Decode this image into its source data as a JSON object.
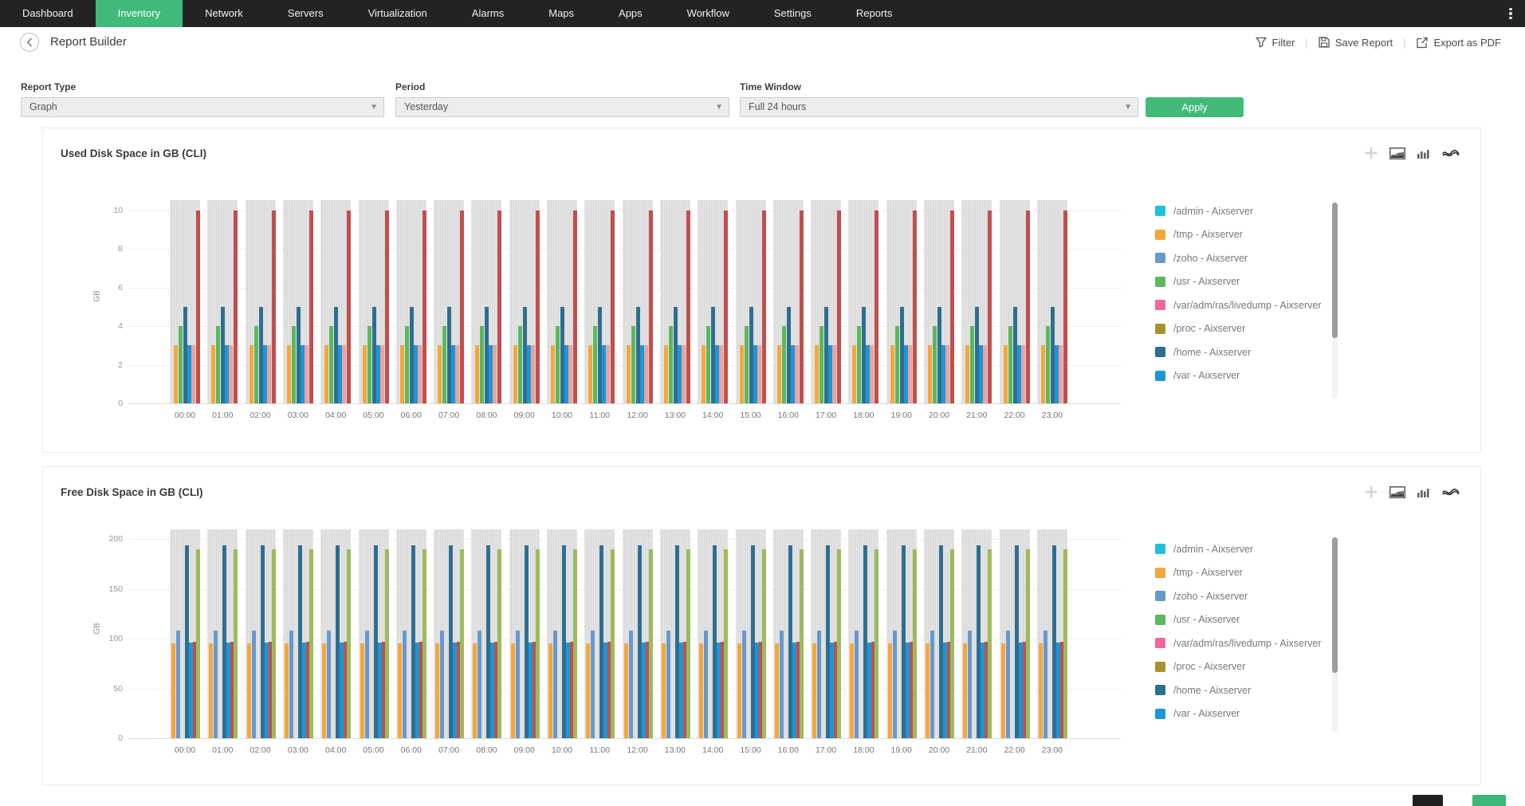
{
  "nav": {
    "items": [
      {
        "label": "Dashboard",
        "active": false
      },
      {
        "label": "Inventory",
        "active": true
      },
      {
        "label": "Network",
        "active": false
      },
      {
        "label": "Servers",
        "active": false
      },
      {
        "label": "Virtualization",
        "active": false
      },
      {
        "label": "Alarms",
        "active": false
      },
      {
        "label": "Maps",
        "active": false
      },
      {
        "label": "Apps",
        "active": false
      },
      {
        "label": "Workflow",
        "active": false
      },
      {
        "label": "Settings",
        "active": false
      },
      {
        "label": "Reports",
        "active": false
      }
    ],
    "overflow_icon": "kebab-menu-icon"
  },
  "header": {
    "title": "Report Builder",
    "back_icon": "chevron-left-icon",
    "actions": [
      {
        "label": "Filter",
        "icon": "filter-icon"
      },
      {
        "label": "Save Report",
        "icon": "save-icon"
      },
      {
        "label": "Export as PDF",
        "icon": "export-icon"
      }
    ]
  },
  "filters": {
    "report_type_label": "Report Type",
    "report_type_value": "Graph",
    "period_label": "Period",
    "period_value": "Yesterday",
    "time_window_label": "Time Window",
    "time_window_value": "Full 24 hours",
    "apply_label": "Apply"
  },
  "panel_tool_icons": [
    "add-icon",
    "area-chart-icon",
    "bar-chart-icon",
    "stream-chart-icon"
  ],
  "legend": [
    {
      "label": "/admin - Aixserver",
      "color": "#1EC1D9"
    },
    {
      "label": "/tmp - Aixserver",
      "color": "#F5A63C"
    },
    {
      "label": "/zoho - Aixserver",
      "color": "#6699CC"
    },
    {
      "label": "/usr - Aixserver",
      "color": "#5CB85C"
    },
    {
      "label": "/var/adm/ras/livedump - Aixserver",
      "color": "#F0679E"
    },
    {
      "label": "/proc - Aixserver",
      "color": "#A89230"
    },
    {
      "label": "/home - Aixserver",
      "color": "#2E6E91"
    },
    {
      "label": "/var - Aixserver",
      "color": "#1E96D6"
    }
  ],
  "chart_data": [
    {
      "type": "bar",
      "title": "Used Disk Space in GB (CLI)",
      "xlabel": "",
      "ylabel": "GB",
      "ylim": [
        0,
        10
      ],
      "yticks": [
        0,
        2,
        4,
        6,
        8,
        10
      ],
      "grid": true,
      "legend_position": "right",
      "legend_scrollable": true,
      "categories": [
        "00:00",
        "01:00",
        "02:00",
        "03:00",
        "04:00",
        "05:00",
        "06:00",
        "07:00",
        "08:00",
        "09:00",
        "10:00",
        "11:00",
        "12:00",
        "13:00",
        "14:00",
        "15:00",
        "16:00",
        "17:00",
        "18:00",
        "19:00",
        "20:00",
        "21:00",
        "22:00",
        "23:00"
      ],
      "series": [
        {
          "name": "/tmp - Aixserver",
          "color": "#F5A63C",
          "value_all_hours": 3
        },
        {
          "name": "/usr - Aixserver",
          "color": "#5CB85C",
          "value_all_hours": 4
        },
        {
          "name": "/home - Aixserver",
          "color": "#2E6E91",
          "value_all_hours": 5
        },
        {
          "name": "/var - Aixserver",
          "color": "#1E96D6",
          "value_all_hours": 3
        },
        {
          "name": "unlabeled-salmon-series",
          "color": "#EBA3A0",
          "value_all_hours": 3
        },
        {
          "name": "unlabeled-red-series",
          "color": "#C0504D",
          "value_all_hours": 10
        }
      ],
      "background_band": {
        "style": "striped-gray",
        "color": "#E0E0E0",
        "extends_above_max_tick": true
      }
    },
    {
      "type": "bar",
      "title": "Free Disk Space in GB (CLI)",
      "xlabel": "",
      "ylabel": "GB",
      "ylim": [
        0,
        200
      ],
      "yticks": [
        0,
        50,
        100,
        150,
        200
      ],
      "grid": true,
      "legend_position": "right",
      "legend_scrollable": true,
      "categories": [
        "00:00",
        "01:00",
        "02:00",
        "03:00",
        "04:00",
        "05:00",
        "06:00",
        "07:00",
        "08:00",
        "09:00",
        "10:00",
        "11:00",
        "12:00",
        "13:00",
        "14:00",
        "15:00",
        "16:00",
        "17:00",
        "18:00",
        "19:00",
        "20:00",
        "21:00",
        "22:00",
        "23:00"
      ],
      "series": [
        {
          "name": "/tmp - Aixserver",
          "color": "#F5A63C",
          "value_all_hours": 95
        },
        {
          "name": "/zoho - Aixserver",
          "color": "#6699CC",
          "value_all_hours": 108
        },
        {
          "name": "/home - Aixserver",
          "color": "#2E6E91",
          "value_all_hours": 194
        },
        {
          "name": "/var - Aixserver",
          "color": "#1E96D6",
          "value_all_hours": 96
        },
        {
          "name": "unlabeled-red-series",
          "color": "#C0504D",
          "value_all_hours": 97
        },
        {
          "name": "unlabeled-olive-series",
          "color": "#9CBB5E",
          "value_all_hours": 190
        }
      ],
      "background_band": {
        "style": "striped-gray",
        "color": "#E0E0E0",
        "extends_above_max_tick": true
      }
    }
  ],
  "colors": {
    "nav_bg": "#232323",
    "accent_green": "#3FBA7A",
    "apply_green": "#41BA77",
    "band_gray": "#E0E0E0"
  }
}
